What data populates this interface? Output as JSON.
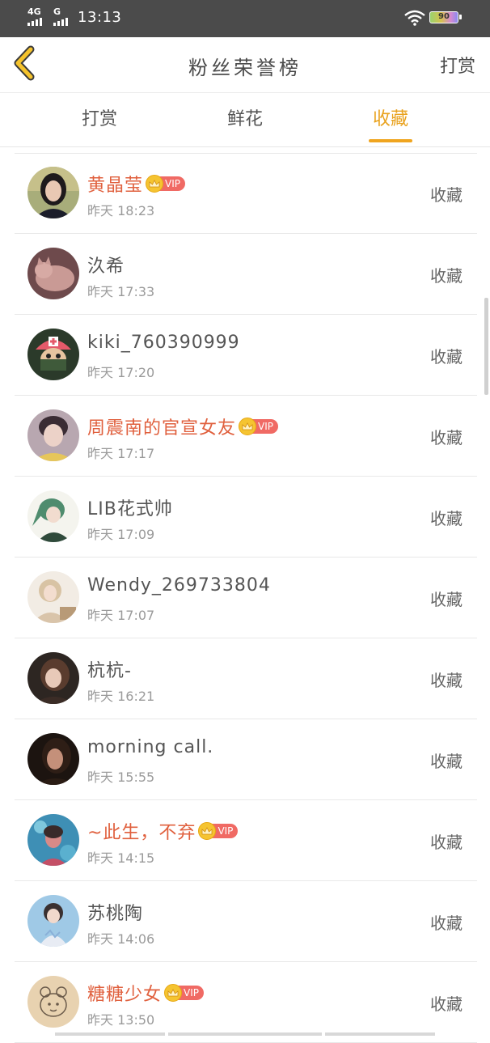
{
  "status_bar": {
    "network1": "4G",
    "network2": "G",
    "time": "13:13",
    "battery": "90"
  },
  "header": {
    "title": "粉丝荣誉榜",
    "action": "打赏"
  },
  "tabs": [
    {
      "label": "打赏",
      "active": false
    },
    {
      "label": "鲜花",
      "active": false
    },
    {
      "label": "收藏",
      "active": true
    }
  ],
  "accent_color": "#f0a51f",
  "vip_name_color": "#e0603e",
  "vip_badge_text": "VIP",
  "rows": [
    {
      "name": "黄晶莹",
      "vip": true,
      "time": "昨天 18:23",
      "action": "收藏",
      "avatar": "avatar-girl-portrait-1"
    },
    {
      "name": "汣希",
      "vip": false,
      "time": "昨天 17:33",
      "action": "收藏",
      "avatar": "avatar-cat"
    },
    {
      "name": "kiki_760390999",
      "vip": false,
      "time": "昨天 17:20",
      "action": "收藏",
      "avatar": "avatar-chopper-cartoon"
    },
    {
      "name": "周震南的官宣女友",
      "vip": true,
      "time": "昨天 17:17",
      "action": "收藏",
      "avatar": "avatar-boy-portrait"
    },
    {
      "name": "LIB花式帅",
      "vip": false,
      "time": "昨天 17:09",
      "action": "收藏",
      "avatar": "avatar-anime-green-hair"
    },
    {
      "name": "Wendy_269733804",
      "vip": false,
      "time": "昨天 17:07",
      "action": "收藏",
      "avatar": "avatar-girl-beige"
    },
    {
      "name": "杭杭-",
      "vip": false,
      "time": "昨天 16:21",
      "action": "收藏",
      "avatar": "avatar-girl-dark"
    },
    {
      "name": "morning call.",
      "vip": false,
      "time": "昨天 15:55",
      "action": "收藏",
      "avatar": "avatar-girl-night"
    },
    {
      "name": "~此生，不弃",
      "vip": true,
      "time": "昨天 14:15",
      "action": "收藏",
      "avatar": "avatar-girl-water"
    },
    {
      "name": "苏桃陶",
      "vip": false,
      "time": "昨天 14:06",
      "action": "收藏",
      "avatar": "avatar-girl-blue"
    },
    {
      "name": "糖糖少女",
      "vip": true,
      "time": "昨天 13:50",
      "action": "收藏",
      "avatar": "avatar-sketch-cartoon"
    }
  ]
}
